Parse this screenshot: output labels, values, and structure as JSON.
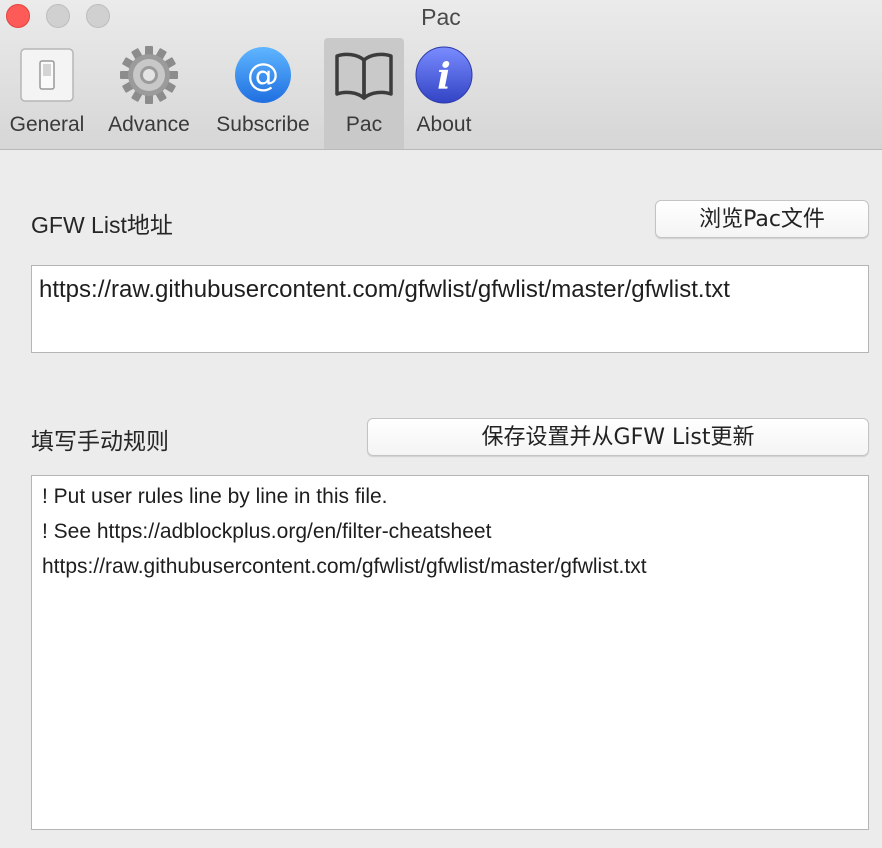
{
  "window": {
    "title": "Pac"
  },
  "toolbar": {
    "items": [
      {
        "label": "General",
        "icon": "switch-icon",
        "selected": false
      },
      {
        "label": "Advance",
        "icon": "gear-icon",
        "selected": false
      },
      {
        "label": "Subscribe",
        "icon": "at-sign-icon",
        "selected": false
      },
      {
        "label": "Pac",
        "icon": "book-icon",
        "selected": true
      },
      {
        "label": "About",
        "icon": "info-icon",
        "selected": false
      }
    ]
  },
  "gfw": {
    "label": "GFW List地址",
    "browse_button": "浏览Pac文件",
    "url_value": "https://raw.githubusercontent.com/gfwlist/gfwlist/master/gfwlist.txt"
  },
  "rules": {
    "label": "填写手动规则",
    "save_button": "保存设置并从GFW List更新",
    "lines": [
      "! Put user rules line by line in this file.",
      "! See https://adblockplus.org/en/filter-cheatsheet",
      "https://raw.githubusercontent.com/gfwlist/gfwlist/master/gfwlist.txt"
    ]
  },
  "colors": {
    "close_button": "#fd5b57",
    "window_background": "#ececec",
    "subscribe_blue": "#2f8ef2",
    "about_purple": "#4a5bd8"
  }
}
